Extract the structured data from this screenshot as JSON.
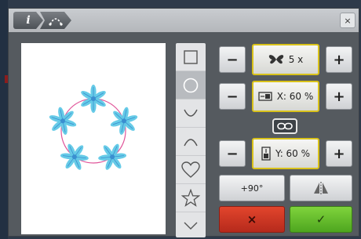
{
  "toolbar": {
    "info_icon_label": "i",
    "close_label": "×"
  },
  "shapes": [
    "square-icon",
    "circle-icon",
    "arc-down-icon",
    "arc-up-icon",
    "heart-icon",
    "star-icon"
  ],
  "controls": {
    "minus_label": "−",
    "plus_label": "+",
    "repeat_value": "5 x",
    "width_value": "X: 60 %",
    "height_value": "Y: 60 %",
    "rotate_label": "+90°",
    "cancel_label": "×",
    "ok_label": "✓"
  },
  "colors": {
    "flower": "#5fc8e6",
    "flower_center": "#3a8fd0",
    "path_circle": "#e0559a",
    "highlight": "#d9c21a"
  }
}
